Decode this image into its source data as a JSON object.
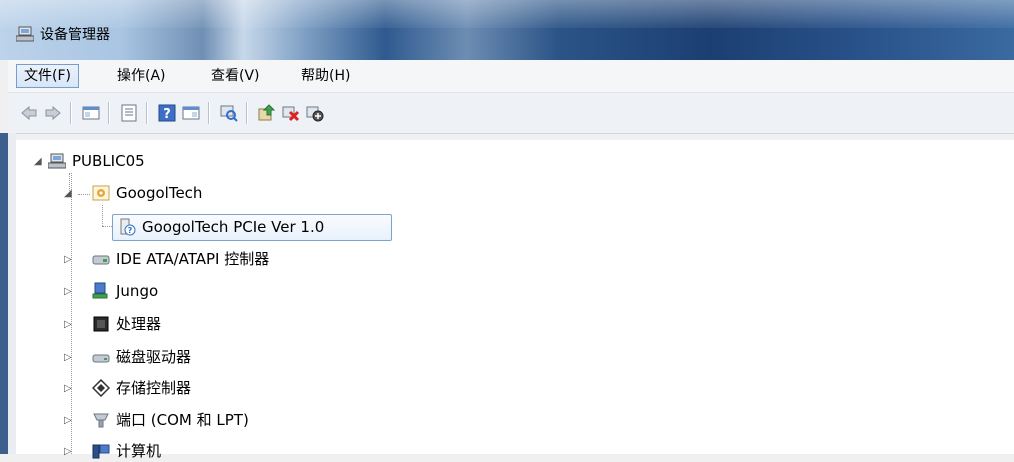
{
  "window": {
    "title": "设备管理器"
  },
  "menu": [
    {
      "label": "文件(F)"
    },
    {
      "label": "操作(A)"
    },
    {
      "label": "查看(V)"
    },
    {
      "label": "帮助(H)"
    }
  ],
  "toolbar": {
    "icons": [
      "back-arrow-icon",
      "forward-arrow-icon",
      "show-hide-console-tree-icon",
      "properties-icon",
      "help-icon",
      "action-pane-icon",
      "scan-hardware-icon",
      "update-driver-icon",
      "uninstall-device-icon",
      "disable-device-icon"
    ]
  },
  "tree": {
    "root": "PUBLIC05",
    "googol": "GoogolTech",
    "googol_child": "GoogolTech PCIe Ver 1.0",
    "items": [
      {
        "label": "IDE ATA/ATAPI 控制器"
      },
      {
        "label": "Jungo"
      },
      {
        "label": "处理器"
      },
      {
        "label": "磁盘驱动器"
      },
      {
        "label": "存储控制器"
      },
      {
        "label": "端口 (COM 和 LPT)"
      },
      {
        "label": "计算机"
      }
    ]
  },
  "colors": {
    "title_bar": "#2b5487",
    "selection_border": "#7da2ce"
  }
}
